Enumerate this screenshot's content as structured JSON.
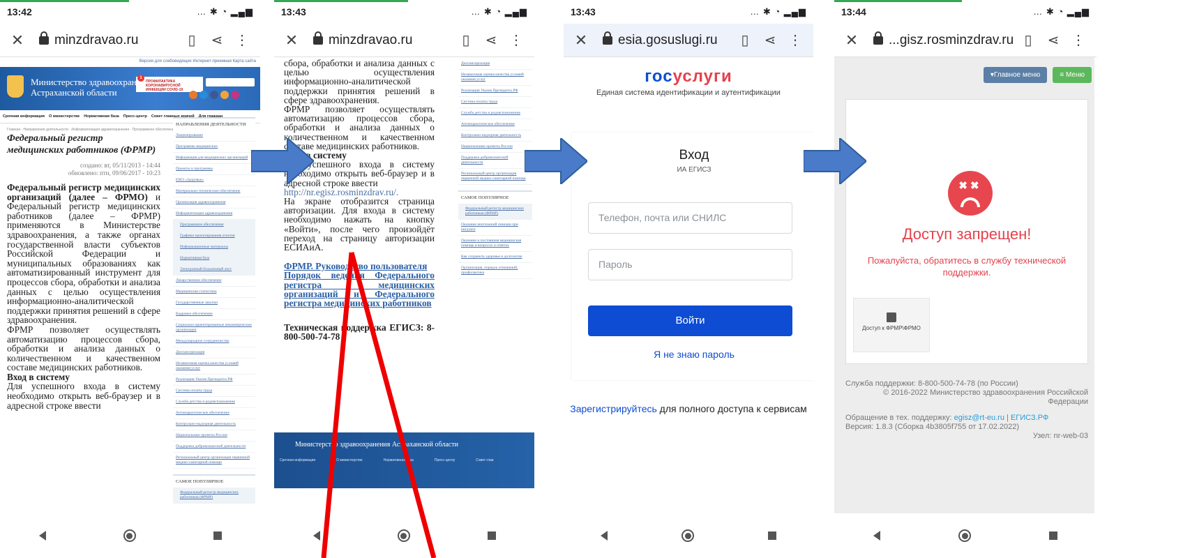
{
  "screens": [
    {
      "time": "13:42",
      "host": "minzdravao.ru",
      "toplinks": "Версия для слабовидящих  Интернет-приемная  Карта сайта",
      "ministry": [
        "Министерство здравоохранения",
        "Астраханской области"
      ],
      "covid": "ПРОФИЛАКТИКА КОРОНАВИРУСНОЙ ИНФЕКЦИИ COVID-19",
      "menu": [
        "Срочная информация",
        "О министерстве",
        "Нормативная база",
        "Пресс-центр",
        "Совет главных врачей",
        "Для граждан"
      ],
      "crumbs": "Главная · Направления деятельности · Информатизация здравоохранения · Программное обеспечение",
      "title": "Федеральный регистр медицинских работников (ФРМР)",
      "created": "создано: вт, 05/11/2013 - 14:44",
      "updated": "обновлено: птн, 09/06/2017 - 10:23",
      "body1_bold": "Федеральный регистр медицинских организаций (далее – ФРМО)",
      "body1": " и Федеральный регистр медицинских работников (далее – ФРМР) применяются в Министерстве здравоохранения, а также органах государственной власти субъектов Российской Федерации и муниципальных образованиях как автоматизированный инструмент для процессов сбора, обработки и анализа данных с целью осуществления информационно-аналитической поддержки принятия решений в сфере здравоохранения.",
      "body2": "ФРМР позволяет осуществлять автоматизацию процессов сбора, обработки и анализа данных о количественном и качественном составе медицинских работников.",
      "login_h": "Вход в систему",
      "login_t": "Для успешного входа в систему необходимо открыть веб-браузер и в адресной строке ввести"
    },
    {
      "time": "13:43",
      "host": "minzdravao.ru",
      "t1": "сбора, обработки и анализа данных с целью осуществления информационно-аналитической поддержки принятия решений в сфере здравоохранения.",
      "t2": "ФРМР позволяет осуществлять автоматизацию процессов сбора, обработки и анализа данных о количественном и качественном составе медицинских работников.",
      "login_h": "Вход в систему",
      "login_t": "Для успешного входа в систему необходимо открыть веб-браузер и в адресной строке ввести",
      "url": "http://nr.egisz.rosminzdrav.ru/.",
      "t3": "На экране отобразится страница авторизации. Для входа в систему необходимо нажать на кнопку «Войти», после чего произойдёт переход на страницу авторизации ЕСИАиА.",
      "link1": "ФРМР. Руководство пользователя",
      "link2": "Порядок ведения Федерального регистра медицинских организаций и Федерального регистра медицинских работников",
      "support_b": "Техническая поддержка ЕГИСЗ:",
      "support_t": " 8-800-500-74-78",
      "footer": "Министерство здравоохранения Астраханской области",
      "footer_cols": [
        "Срочная информация",
        "О министерстве",
        "Нормативная база",
        "Пресс-центр",
        "Совет глав"
      ]
    },
    {
      "time": "13:43",
      "host": "esia.gosuslugi.ru",
      "logo_a": "гос",
      "logo_b": "услуги",
      "subtitle": "Единая система идентификации и аутентификации",
      "heading": "Вход",
      "sub_heading": "ИА ЕГИСЗ",
      "login_placeholder": "Телефон, почта или СНИЛС",
      "password_placeholder": "Пароль",
      "submit": "Войти",
      "forgot": "Я не знаю пароль",
      "register_link": "Зарегистрируйтесь",
      "register_text": " для полного доступа к сервисам"
    },
    {
      "time": "13:44",
      "host": "...gisz.rosminzdrav.ru",
      "main_menu": "▾Главное меню",
      "menu": "≡ Меню",
      "denied": "Доступ запрещен!",
      "message": "Пожалуйста, обратитесь в службу технической поддержки.",
      "tile": "Доступ к ФРМР\\ФРМО",
      "support": "Служба поддержки: 8-800-500-74-78 (по России)",
      "copyright": "© 2016-2022 Министерство здравоохранения Российской Федерации",
      "tech_prefix": "Обращение в тех. поддержку: ",
      "tech_email": "egisz@rt-eu.ru",
      "tech_sep": "  |  ",
      "tech_site": "ЕГИСЗ.РФ",
      "version": "Версия: 1.8.3 (Сборка 4b3805f755 от 17.02.2022)",
      "node": "Узел: nr-web-03"
    }
  ],
  "sidebar": {
    "header1": "НАПРАВЛЕНИЯ ДЕЯТЕЛЬНОСТИ",
    "items": [
      "Лицензирование",
      "Программы медицинских",
      "Информация для медицинских организаций",
      "Проекты и программы",
      "ЕМЭ «Здоровье»",
      "Материально-техническое обеспечение",
      "Организация здравоохранения",
      "Информатизация здравоохранения",
      "Программное обеспечение",
      "Графики проектирования отчетов",
      "Информационные материалы",
      "Нормативная база",
      "Электронный больничный лист",
      "Лекарственное обеспечение",
      "Медицинская статистика",
      "Государственные закупки",
      "Кадровое обеспечение",
      "Социально-ориентированные некоммерческие организации",
      "Международное сотрудничество",
      "Диспансеризация",
      "Независимая оценка качества условий оказания услуг",
      "Реализация Указов Президента РФ",
      "Система оплаты труда",
      "Служба детства и родовспоможения",
      "Антинаркотическое обеспечение",
      "Контрольно-надзорная деятельность",
      "Национальные проекты России",
      "Поддержка добровольческой деятельности",
      "Региональный центр организации первичной медико-санитарной помощи"
    ],
    "header2": "САМОЕ ПОПУЛЯРНОЕ",
    "popular": [
      "Федеральный регистр медицинских работников (ФРМР)",
      "Оказание неотложной помощи при инсульте",
      "Оказание и постоянная медицинская помощь в вопросах и ответах",
      "Как сохранить здоровье и долголетие",
      "Организация, порядок отношений, профилактика"
    ]
  },
  "colors": {
    "gosblue": "#0d4cd3",
    "gosred": "#e4424d",
    "arrow": "#4a7bc8",
    "annot": "#ee0000"
  }
}
